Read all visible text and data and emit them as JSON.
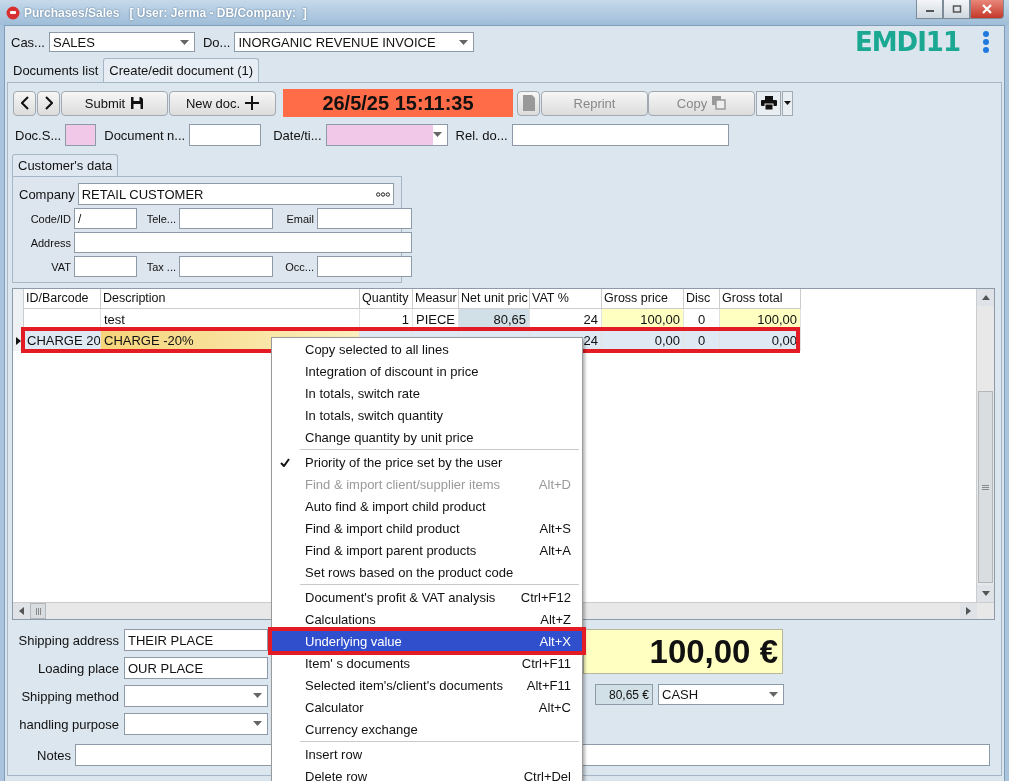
{
  "window": {
    "title": "Purchases/Sales",
    "subtitle": "[ User: Jerma - DB/Company:  ]"
  },
  "header": {
    "case_label": "Cas...",
    "case_value": "SALES",
    "doc_label": "Do...",
    "doc_value": "INORGANIC REVENUE INVOICE",
    "logo": "EMDI11"
  },
  "tabs": [
    {
      "label": "Documents list",
      "selected": false
    },
    {
      "label": "Create/edit document (1)",
      "selected": true
    }
  ],
  "toolbar": {
    "submit": {
      "label": "Submit",
      "disabled": false
    },
    "new_doc": {
      "label": "New doc.",
      "disabled": false
    },
    "clock": "26/5/25 15:11:35",
    "reprint": {
      "label": "Reprint",
      "disabled": true
    },
    "copy": {
      "label": "Copy",
      "disabled": true
    }
  },
  "doc_fields": [
    {
      "label": "Doc.S...",
      "kind": "swatch"
    },
    {
      "label": "Document n...",
      "kind": "text"
    },
    {
      "label": "Date/ti...",
      "kind": "date"
    },
    {
      "label": "Rel. do...",
      "kind": "wide"
    }
  ],
  "customer": {
    "tab": "Customer's data",
    "company_label": "Company",
    "company": "RETAIL CUSTOMER",
    "rows": [
      {
        "fields": [
          {
            "label": "Code/ID",
            "value": "/"
          },
          {
            "label": "Tele..."
          },
          {
            "label": "Email"
          }
        ]
      },
      {
        "fields": [
          {
            "label": "Address"
          }
        ]
      },
      {
        "fields": [
          {
            "label": "VAT"
          },
          {
            "label": "Tax ..."
          },
          {
            "label": "Occ..."
          }
        ]
      }
    ]
  },
  "table": {
    "columns": [
      {
        "label": "ID/Barcode",
        "kind": "text"
      },
      {
        "label": "Description",
        "kind": "desc"
      },
      {
        "label": "Quantity",
        "kind": "number"
      },
      {
        "label": "Measur",
        "kind": "text"
      },
      {
        "label": "Net unit pric",
        "kind": "net"
      },
      {
        "label": "VAT %",
        "kind": "number"
      },
      {
        "label": "Gross price",
        "kind": "gross"
      },
      {
        "label": "Disc",
        "kind": "center"
      },
      {
        "label": "Gross total",
        "kind": "gross"
      }
    ],
    "rows": [
      {
        "current": false,
        "annotated": false,
        "cells": [
          null,
          "test",
          "1",
          "PIECE",
          "80,65",
          "24",
          "100,00",
          "0",
          "100,00"
        ]
      },
      {
        "current": true,
        "annotated": true,
        "cells": [
          "CHARGE 20",
          "CHARGE -20%",
          null,
          null,
          null,
          "24",
          "0,00",
          "0",
          "0,00"
        ]
      }
    ]
  },
  "bottom": {
    "fields": [
      {
        "label": "Shipping address",
        "value": "THEIR PLACE",
        "kind": "text"
      },
      {
        "label": "Loading place",
        "value": "OUR PLACE",
        "kind": "text"
      },
      {
        "label": "Shipping method",
        "kind": "select"
      },
      {
        "label": "handling purpose",
        "kind": "select"
      }
    ],
    "total": "100,00 €",
    "net": "80,65 €",
    "payment": "CASH",
    "notes_label": "Notes"
  },
  "menu": {
    "groups": [
      {
        "items": [
          {
            "label": "Copy selected to all lines",
            "checked": false,
            "disabled": false,
            "selected": false,
            "annotated": false
          },
          {
            "label": "Integration of discount in price",
            "checked": false,
            "disabled": false,
            "selected": false,
            "annotated": false
          },
          {
            "label": "In totals, switch rate",
            "checked": false,
            "disabled": false,
            "selected": false,
            "annotated": false
          },
          {
            "label": "In totals, switch quantity",
            "checked": false,
            "disabled": false,
            "selected": false,
            "annotated": false
          },
          {
            "label": "Change quantity by unit price",
            "checked": false,
            "disabled": false,
            "selected": false,
            "annotated": false
          }
        ]
      },
      {
        "items": [
          {
            "label": "Priority of the price set by the user",
            "checked": true,
            "disabled": false,
            "selected": false,
            "annotated": false
          },
          {
            "label": "Find & import client/supplier items",
            "shortcut": "Alt+D",
            "checked": false,
            "disabled": true,
            "selected": false,
            "annotated": false
          },
          {
            "label": "Auto find & import child product",
            "checked": false,
            "disabled": false,
            "selected": false,
            "annotated": false
          },
          {
            "label": "Find & import child product",
            "shortcut": "Alt+S",
            "checked": false,
            "disabled": false,
            "selected": false,
            "annotated": false
          },
          {
            "label": "Find & import parent products",
            "shortcut": "Alt+A",
            "checked": false,
            "disabled": false,
            "selected": false,
            "annotated": false
          },
          {
            "label": "Set rows based on the product code",
            "checked": false,
            "disabled": false,
            "selected": false,
            "annotated": false
          }
        ]
      },
      {
        "items": [
          {
            "label": "Document's profit & VAT analysis",
            "shortcut": "Ctrl+F12",
            "checked": false,
            "disabled": false,
            "selected": false,
            "annotated": false
          },
          {
            "label": "Calculations",
            "shortcut": "Alt+Z",
            "checked": false,
            "disabled": false,
            "selected": false,
            "annotated": false
          },
          {
            "label": "Underlying value",
            "shortcut": "Alt+X",
            "checked": false,
            "disabled": false,
            "selected": true,
            "annotated": true
          },
          {
            "label": "Item' s documents",
            "shortcut": "Ctrl+F11",
            "checked": false,
            "disabled": false,
            "selected": false,
            "annotated": false
          },
          {
            "label": "Selected item's/client's documents",
            "shortcut": "Alt+F11",
            "checked": false,
            "disabled": false,
            "selected": false,
            "annotated": false
          },
          {
            "label": "Calculator",
            "shortcut": "Alt+C",
            "checked": false,
            "disabled": false,
            "selected": false,
            "annotated": false
          },
          {
            "label": "Currency exchange",
            "checked": false,
            "disabled": false,
            "selected": false,
            "annotated": false
          }
        ]
      },
      {
        "items": [
          {
            "label": "Insert row",
            "checked": false,
            "disabled": false,
            "selected": false,
            "annotated": false
          },
          {
            "label": "Delete row",
            "shortcut": "Ctrl+Del",
            "checked": false,
            "disabled": false,
            "selected": false,
            "annotated": false
          }
        ]
      }
    ]
  }
}
